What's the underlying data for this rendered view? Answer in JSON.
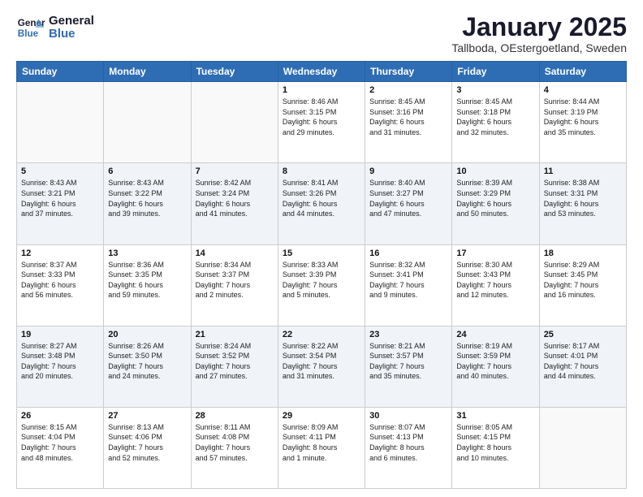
{
  "logo": {
    "line1": "General",
    "line2": "Blue"
  },
  "title": "January 2025",
  "subtitle": "Tallboda, OEstergoetland, Sweden",
  "days": [
    "Sunday",
    "Monday",
    "Tuesday",
    "Wednesday",
    "Thursday",
    "Friday",
    "Saturday"
  ],
  "weeks": [
    [
      {
        "day": "",
        "text": ""
      },
      {
        "day": "",
        "text": ""
      },
      {
        "day": "",
        "text": ""
      },
      {
        "day": "1",
        "text": "Sunrise: 8:46 AM\nSunset: 3:15 PM\nDaylight: 6 hours\nand 29 minutes."
      },
      {
        "day": "2",
        "text": "Sunrise: 8:45 AM\nSunset: 3:16 PM\nDaylight: 6 hours\nand 31 minutes."
      },
      {
        "day": "3",
        "text": "Sunrise: 8:45 AM\nSunset: 3:18 PM\nDaylight: 6 hours\nand 32 minutes."
      },
      {
        "day": "4",
        "text": "Sunrise: 8:44 AM\nSunset: 3:19 PM\nDaylight: 6 hours\nand 35 minutes."
      }
    ],
    [
      {
        "day": "5",
        "text": "Sunrise: 8:43 AM\nSunset: 3:21 PM\nDaylight: 6 hours\nand 37 minutes."
      },
      {
        "day": "6",
        "text": "Sunrise: 8:43 AM\nSunset: 3:22 PM\nDaylight: 6 hours\nand 39 minutes."
      },
      {
        "day": "7",
        "text": "Sunrise: 8:42 AM\nSunset: 3:24 PM\nDaylight: 6 hours\nand 41 minutes."
      },
      {
        "day": "8",
        "text": "Sunrise: 8:41 AM\nSunset: 3:26 PM\nDaylight: 6 hours\nand 44 minutes."
      },
      {
        "day": "9",
        "text": "Sunrise: 8:40 AM\nSunset: 3:27 PM\nDaylight: 6 hours\nand 47 minutes."
      },
      {
        "day": "10",
        "text": "Sunrise: 8:39 AM\nSunset: 3:29 PM\nDaylight: 6 hours\nand 50 minutes."
      },
      {
        "day": "11",
        "text": "Sunrise: 8:38 AM\nSunset: 3:31 PM\nDaylight: 6 hours\nand 53 minutes."
      }
    ],
    [
      {
        "day": "12",
        "text": "Sunrise: 8:37 AM\nSunset: 3:33 PM\nDaylight: 6 hours\nand 56 minutes."
      },
      {
        "day": "13",
        "text": "Sunrise: 8:36 AM\nSunset: 3:35 PM\nDaylight: 6 hours\nand 59 minutes."
      },
      {
        "day": "14",
        "text": "Sunrise: 8:34 AM\nSunset: 3:37 PM\nDaylight: 7 hours\nand 2 minutes."
      },
      {
        "day": "15",
        "text": "Sunrise: 8:33 AM\nSunset: 3:39 PM\nDaylight: 7 hours\nand 5 minutes."
      },
      {
        "day": "16",
        "text": "Sunrise: 8:32 AM\nSunset: 3:41 PM\nDaylight: 7 hours\nand 9 minutes."
      },
      {
        "day": "17",
        "text": "Sunrise: 8:30 AM\nSunset: 3:43 PM\nDaylight: 7 hours\nand 12 minutes."
      },
      {
        "day": "18",
        "text": "Sunrise: 8:29 AM\nSunset: 3:45 PM\nDaylight: 7 hours\nand 16 minutes."
      }
    ],
    [
      {
        "day": "19",
        "text": "Sunrise: 8:27 AM\nSunset: 3:48 PM\nDaylight: 7 hours\nand 20 minutes."
      },
      {
        "day": "20",
        "text": "Sunrise: 8:26 AM\nSunset: 3:50 PM\nDaylight: 7 hours\nand 24 minutes."
      },
      {
        "day": "21",
        "text": "Sunrise: 8:24 AM\nSunset: 3:52 PM\nDaylight: 7 hours\nand 27 minutes."
      },
      {
        "day": "22",
        "text": "Sunrise: 8:22 AM\nSunset: 3:54 PM\nDaylight: 7 hours\nand 31 minutes."
      },
      {
        "day": "23",
        "text": "Sunrise: 8:21 AM\nSunset: 3:57 PM\nDaylight: 7 hours\nand 35 minutes."
      },
      {
        "day": "24",
        "text": "Sunrise: 8:19 AM\nSunset: 3:59 PM\nDaylight: 7 hours\nand 40 minutes."
      },
      {
        "day": "25",
        "text": "Sunrise: 8:17 AM\nSunset: 4:01 PM\nDaylight: 7 hours\nand 44 minutes."
      }
    ],
    [
      {
        "day": "26",
        "text": "Sunrise: 8:15 AM\nSunset: 4:04 PM\nDaylight: 7 hours\nand 48 minutes."
      },
      {
        "day": "27",
        "text": "Sunrise: 8:13 AM\nSunset: 4:06 PM\nDaylight: 7 hours\nand 52 minutes."
      },
      {
        "day": "28",
        "text": "Sunrise: 8:11 AM\nSunset: 4:08 PM\nDaylight: 7 hours\nand 57 minutes."
      },
      {
        "day": "29",
        "text": "Sunrise: 8:09 AM\nSunset: 4:11 PM\nDaylight: 8 hours\nand 1 minute."
      },
      {
        "day": "30",
        "text": "Sunrise: 8:07 AM\nSunset: 4:13 PM\nDaylight: 8 hours\nand 6 minutes."
      },
      {
        "day": "31",
        "text": "Sunrise: 8:05 AM\nSunset: 4:15 PM\nDaylight: 8 hours\nand 10 minutes."
      },
      {
        "day": "",
        "text": ""
      }
    ]
  ]
}
